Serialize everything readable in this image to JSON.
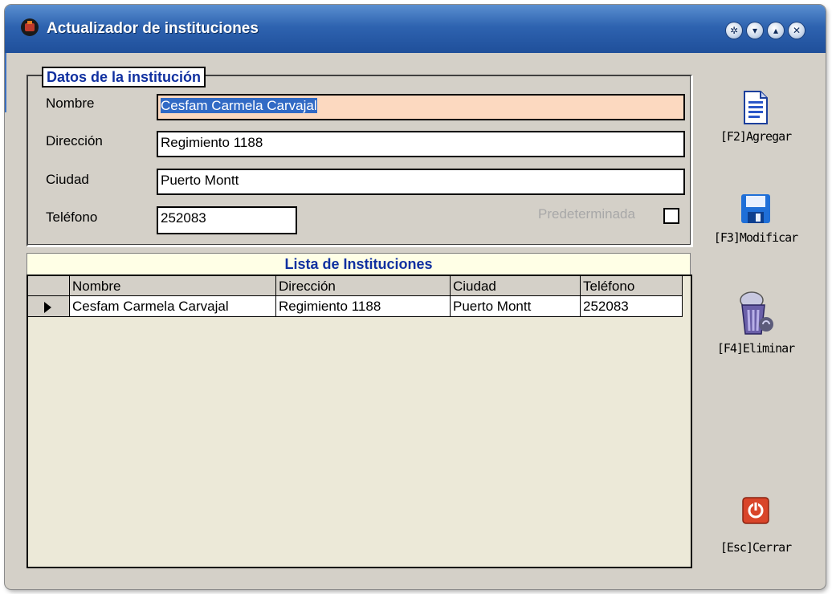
{
  "window": {
    "title": "Actualizador de instituciones"
  },
  "group": {
    "title": "Datos de la institución"
  },
  "form": {
    "nombre_label": "Nombre",
    "nombre_value": "Cesfam Carmela Carvajal",
    "direccion_label": "Dirección",
    "direccion_value": "Regimiento 1188",
    "ciudad_label": "Ciudad",
    "ciudad_value": "Puerto Montt",
    "telefono_label": "Teléfono",
    "telefono_value": "252083",
    "predeterminada_label": "Predeterminada",
    "predeterminada_checked": false
  },
  "list": {
    "title": "Lista de Instituciones",
    "columns": [
      "Nombre",
      "Dirección",
      "Ciudad",
      "Teléfono"
    ],
    "rows": [
      [
        "Cesfam Carmela Carvajal",
        "Regimiento 1188",
        "Puerto Montt",
        "252083"
      ]
    ]
  },
  "actions": {
    "agregar": "[F2]Agregar",
    "modificar": "[F3]Modificar",
    "eliminar": "[F4]Eliminar",
    "cerrar": "[Esc]Cerrar"
  },
  "icons": {
    "title": "app-icon",
    "agregar": "new-document-icon",
    "modificar": "floppy-disk-icon",
    "eliminar": "recycle-bin-icon",
    "cerrar": "power-icon"
  },
  "colors": {
    "titlebar": "#2e63b0",
    "active_field": "#fcd9c0",
    "grid_title_text": "#1030a0",
    "close_button": "#d9452a"
  }
}
